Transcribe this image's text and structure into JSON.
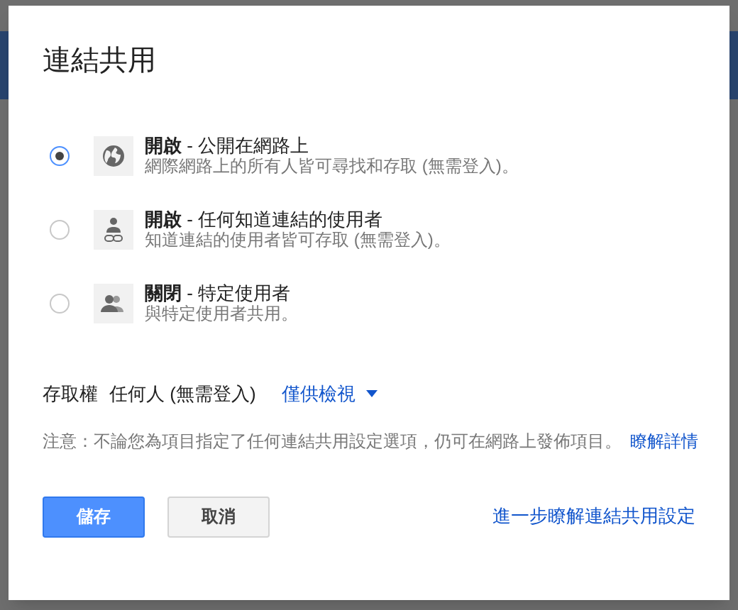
{
  "dialog": {
    "title": "連結共用",
    "options": [
      {
        "kind": "globe",
        "label": "**開啟** - 公開在網路上",
        "description": "網際網路上的所有人皆可尋找和存取 (無需登入)。",
        "selected": true
      },
      {
        "kind": "link",
        "label": "**開啟** - 任何知道連結的使用者",
        "description": "知道連結的使用者皆可存取 (無需登入)。",
        "selected": false
      },
      {
        "kind": "people",
        "label": "**關閉** - 特定使用者",
        "description": "與特定使用者共用。",
        "selected": false
      }
    ],
    "access": {
      "label": "存取權",
      "value": "任何人 (無需登入)",
      "permission": "僅供檢視"
    },
    "note": {
      "text": "注意：不論您為項目指定了任何連結共用設定選項，仍可在網路上發佈項目。",
      "link": "瞭解詳情"
    },
    "buttons": [
      {
        "label": "儲存",
        "kind": "primary"
      },
      {
        "label": "取消",
        "kind": "secondary"
      }
    ],
    "help_link": "進一步瞭解連結共用設定"
  }
}
